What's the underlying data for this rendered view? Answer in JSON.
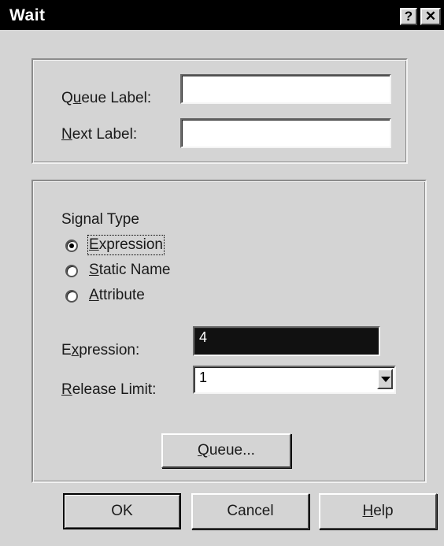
{
  "window": {
    "title": "Wait",
    "help_button": "?",
    "close_button": "✕"
  },
  "labels_group": {
    "queue_label": {
      "prefix": "Q",
      "accel": "u",
      "rest": "eue Label:",
      "value": ""
    },
    "next_label": {
      "prefix": "",
      "accel": "N",
      "rest": "ext Label:",
      "value": ""
    }
  },
  "signal_group": {
    "signal_type_heading": "Signal Type",
    "options": [
      {
        "accel": "E",
        "rest": "xpression",
        "selected": true
      },
      {
        "accel": "S",
        "rest": "tatic Name",
        "selected": false
      },
      {
        "accel": "A",
        "rest": "ttribute",
        "selected": false
      }
    ],
    "expression": {
      "prefix": "E",
      "accel": "x",
      "rest": "pression:",
      "value": "4"
    },
    "release_limit": {
      "prefix": "",
      "accel": "R",
      "rest": "elease Limit:",
      "value": "1"
    },
    "queue_button": {
      "accel": "Q",
      "rest": "ueue..."
    }
  },
  "footer": {
    "ok": "OK",
    "cancel": "Cancel",
    "help": {
      "accel": "H",
      "rest": "elp"
    }
  }
}
